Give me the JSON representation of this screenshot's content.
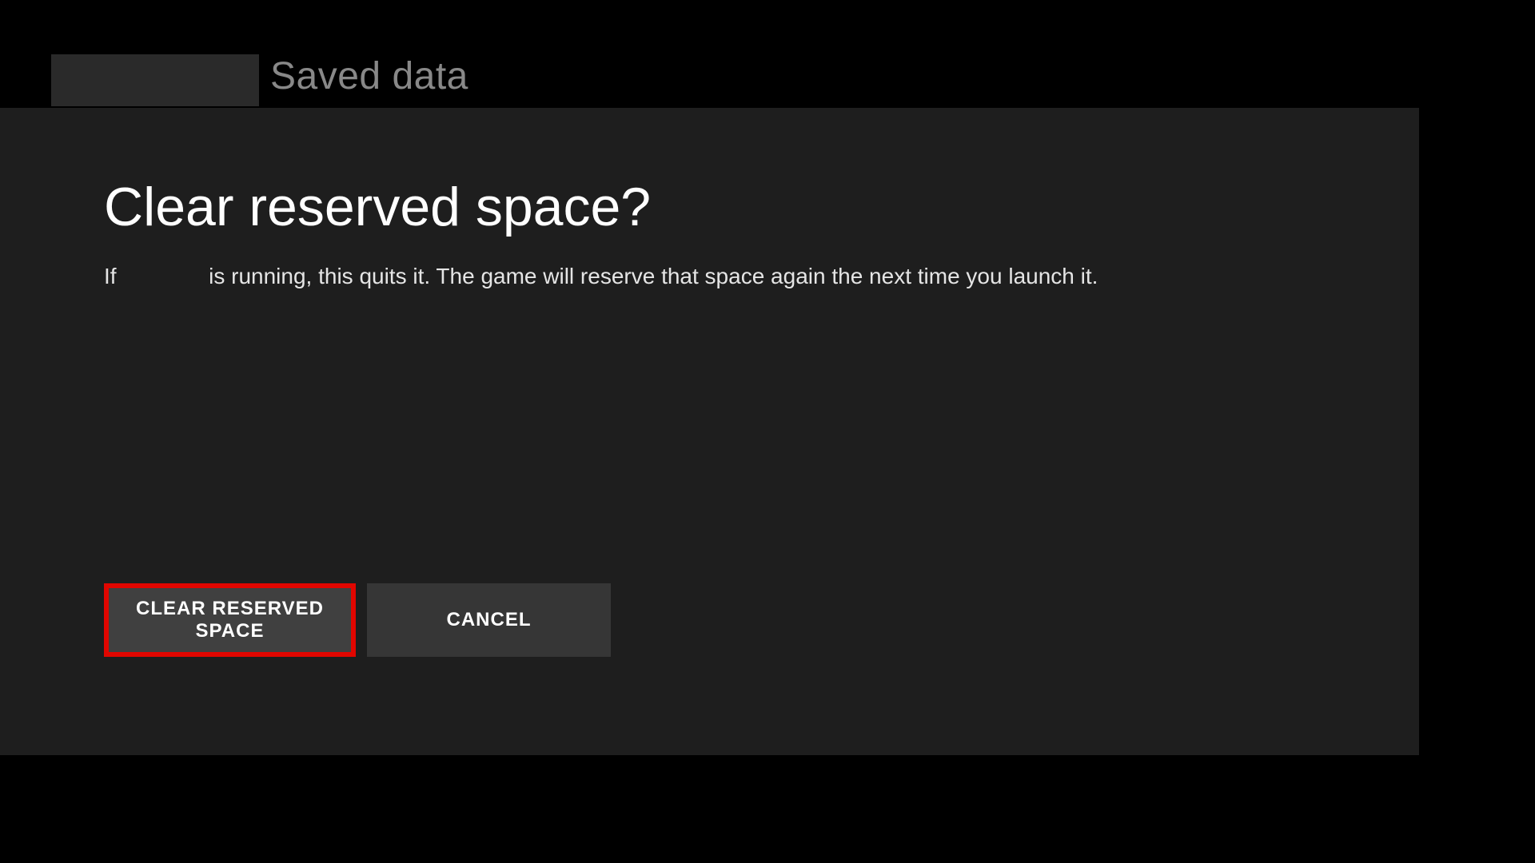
{
  "header": {
    "breadcrumb_title": "Saved data"
  },
  "dialog": {
    "title": "Clear reserved space?",
    "body_prefix": "If",
    "body_suffix": "is running, this quits it. The game will reserve that space again the next time you launch it."
  },
  "buttons": {
    "confirm_label": "CLEAR RESERVED SPACE",
    "cancel_label": "CANCEL"
  }
}
